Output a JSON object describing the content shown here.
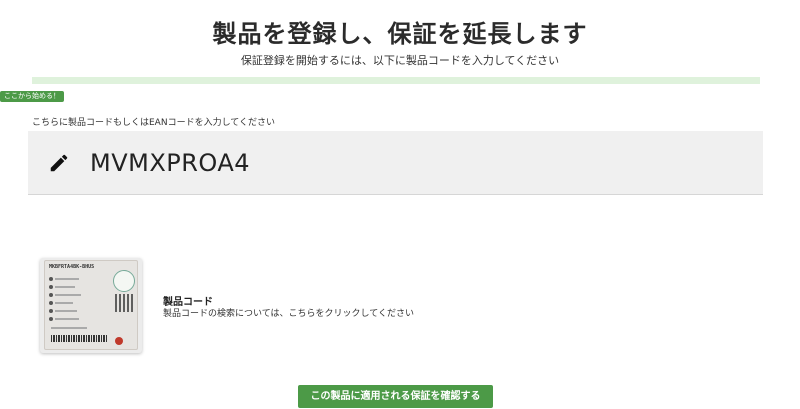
{
  "header": {
    "title": "製品を登録し、保証を延長します",
    "subtitle": "保証登録を開始するには、以下に製品コードを入力してください"
  },
  "progress": {
    "fraction": 1.0,
    "color": "#dff2dc"
  },
  "start_badge": "ここから始める！",
  "code_input": {
    "label": "こちらに製品コードもしくはEANコードを入力してください",
    "value": "MVMXPROA4",
    "icon": "pencil-icon"
  },
  "product_code_help": {
    "image_label_text": "MKBFRTA4BK-BHUS",
    "title": "製品コード",
    "description": "製品コードの検索については、こちらをクリックしてください"
  },
  "confirm_button": {
    "label": "この製品に適用される保証を確認する"
  },
  "colors": {
    "accent": "#4c9a47",
    "progress": "#dff2dc",
    "input_bg": "#f0f0f0"
  }
}
